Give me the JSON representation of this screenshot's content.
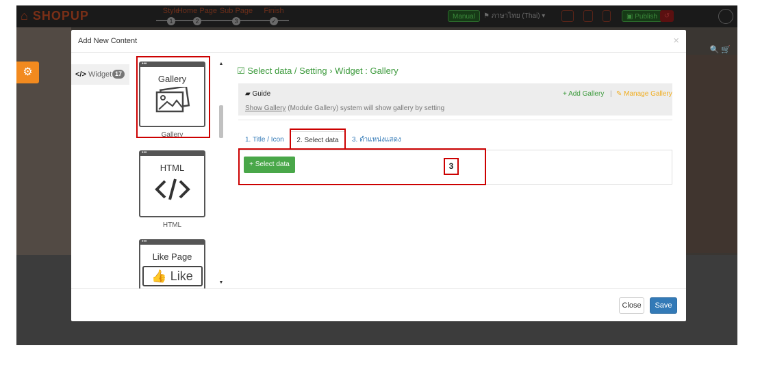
{
  "app": {
    "brand": "SHOPUP",
    "steps": [
      {
        "label": "Style",
        "num": "1"
      },
      {
        "label": "Home Page",
        "num": "2"
      },
      {
        "label": "Sub Page",
        "num": "3"
      },
      {
        "label": "Finish",
        "num": "✓"
      }
    ],
    "manual_label": "Manual",
    "language_label": "⚑ ภาษาไทย (Thai) ▾",
    "publish_label": "Publish",
    "undo_label": "↺",
    "site_icons": "🔍 🛒"
  },
  "modal": {
    "title": "Add New Content",
    "close_symbol": "×",
    "category": {
      "label": "Widget",
      "code": "</>",
      "count": "17"
    },
    "widgets": [
      {
        "title": "Gallery",
        "caption": "Gallery",
        "icon": "gallery-icon"
      },
      {
        "title": "HTML",
        "caption": "HTML",
        "icon": "code-icon"
      },
      {
        "title": "Like Page",
        "caption": "",
        "icon": "thumbs-up-icon",
        "icon_text": "Like"
      }
    ],
    "content": {
      "heading": "☑ Select data / Setting › Widget : Gallery",
      "guide_label": "Guide",
      "guide_link": "Show Gallery",
      "guide_text": " (Module Gallery) system will show gallery by setting",
      "add_gallery": "+ Add Gallery",
      "separator": "|",
      "manage_gallery": "✎ Manage Gallery",
      "tabs": [
        "1. Title / Icon",
        "2. Select data",
        "3. ตำแหน่งแสดง"
      ],
      "active_tab": 1,
      "select_data_button": "+ Select data",
      "annotation_number": "3"
    },
    "footer": {
      "close_label": "Close",
      "save_label": "Save"
    }
  },
  "colors": {
    "green": "#49a749",
    "blue": "#337ab7",
    "orange": "#f28a1f",
    "highlight_red": "#cc0000"
  }
}
